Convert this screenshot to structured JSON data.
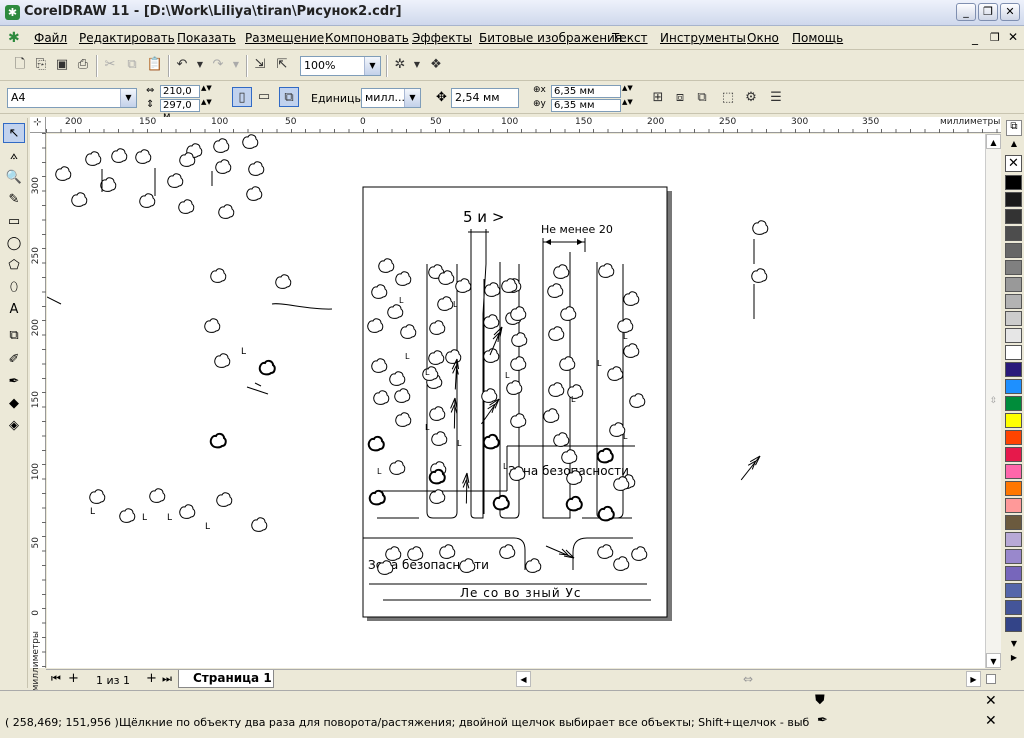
{
  "window": {
    "title": "CorelDRAW 11 - [D:\\Work\\Liliya\\tiran\\Рисунок2.cdr]",
    "minimize": "_",
    "maximize": "❐",
    "close": "✕"
  },
  "menu": [
    "Файл",
    "Редактировать",
    "Показать",
    "Размещение",
    "Компоновать",
    "Эффекты",
    "Битовые изображения",
    "Текст",
    "Инструменты",
    "Окно",
    "Помощь"
  ],
  "toolbar": {
    "zoom": "100%"
  },
  "property_bar": {
    "page_size": "A4",
    "width": "210,0 м",
    "height": "297,0 м",
    "units_label": "Единицы:",
    "units_value": "милл...",
    "nudge": "2,54 мм",
    "dup_x": "6,35 мм",
    "dup_y": "6,35 мм"
  },
  "ruler": {
    "unit": "миллиметры",
    "h_ticks": [
      "200",
      "150",
      "100",
      "50",
      "0",
      "50",
      "100",
      "150",
      "200",
      "250",
      "300",
      "350"
    ],
    "v_ticks": [
      "300",
      "250",
      "200",
      "150",
      "100",
      "50",
      "0"
    ]
  },
  "drawing": {
    "label_width": "5 и >",
    "label_min": "Не менее 20",
    "zone_top": "Зона безопасности",
    "zone_bottom": "Зона безопасности",
    "road": "Ле со во зный Ус"
  },
  "pager": {
    "page_count": "1 из 1",
    "tab": "Страница 1"
  },
  "status": {
    "coords": "( 258,469; 151,956 )",
    "hint": "Щёлкние по объекту два раза для поворота/растяжения; двойной щелчок выбирает все объекты; Shift+щелчок - выбор нескольких; А..."
  },
  "palette_colors": [
    "#000000",
    "#1a1a1a",
    "#333333",
    "#4d4d4d",
    "#666666",
    "#808080",
    "#999999",
    "#b3b3b3",
    "#cccccc",
    "#e6e6e6",
    "#ffffff",
    "#2a1a7a",
    "#1e90ff",
    "#008c3a",
    "#ffff00",
    "#ff4400",
    "#e6194b",
    "#ff66aa",
    "#ff7700",
    "#ff9999",
    "#6b5a3e",
    "#b8a9d6",
    "#9988cc",
    "#7766bb",
    "#5566aa",
    "#445599",
    "#334488"
  ]
}
